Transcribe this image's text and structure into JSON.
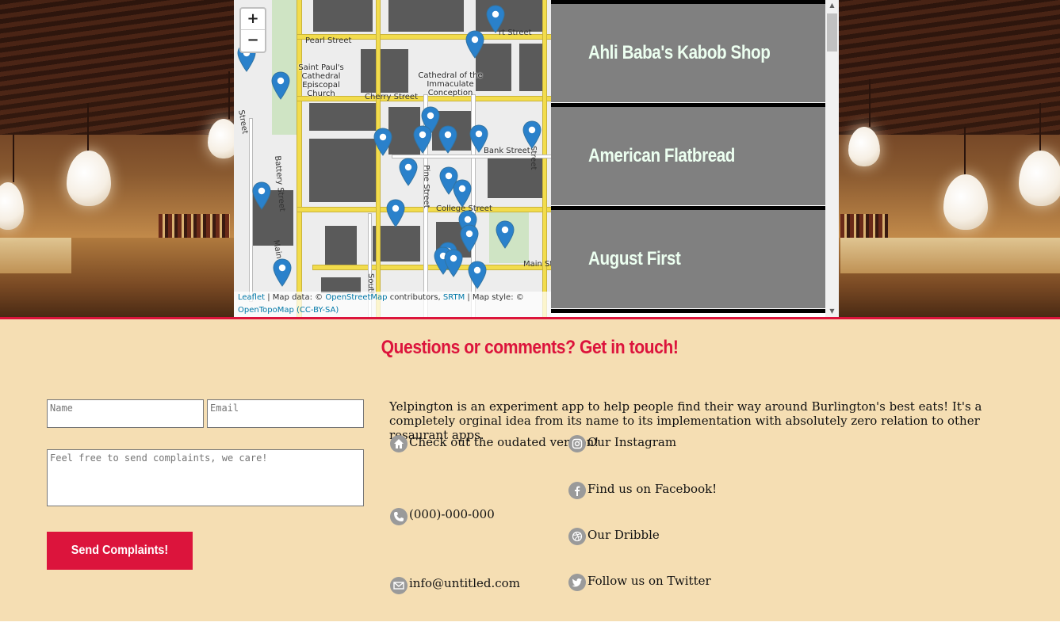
{
  "map": {
    "zoom_in": "+",
    "zoom_out": "−",
    "street_labels": [
      "Pearl Street",
      "Cherry Street",
      "Bank Street",
      "College Street",
      "Main Street",
      "Battery Street",
      "Pine Street",
      "South",
      "Street",
      "Main S",
      "Street",
      "rt Street"
    ],
    "poi_labels": [
      "Saint Paul's Cathedral Episcopal Church",
      "Cathedral of the Immaculate Conception"
    ],
    "attribution": {
      "leaflet": "Leaflet",
      "sep1": " | Map data: © ",
      "osm": "OpenStreetMap",
      "contrib": " contributors, ",
      "srtm": "SRTM",
      "style": " | Map style: © ",
      "otm": "OpenTopoMap",
      "license": "(CC-BY-SA)"
    },
    "marker_color": "#2a81cb"
  },
  "restaurants": [
    {
      "name": "Ahli Baba's Kabob Shop"
    },
    {
      "name": "American Flatbread"
    },
    {
      "name": "August First"
    }
  ],
  "contact": {
    "heading": "Questions or comments? Get in touch!",
    "name_placeholder": "Name",
    "email_placeholder": "Email",
    "message_placeholder": "Feel free to send complaints, we care!",
    "send_label": "Send Complaints!",
    "about": "Yelpington is an experiment app to help people find their way around Burlington's best eats! It's a completely orginal idea from its name to its implementation with absolutely zero relation to other resaurant apps.",
    "links": {
      "outdated": "Check out the oudated version!",
      "instagram": "Our Instagram",
      "facebook": "Find us on Facebook!",
      "phone": "(000)-000-000",
      "dribble": "Our Dribble",
      "email": "info@untitled.com",
      "twitter": "Follow us on Twitter"
    }
  },
  "colors": {
    "accent": "#dc143c",
    "section_bg": "#f5deb3",
    "list_item_bg": "#808080",
    "list_text": "#ecfff0"
  }
}
